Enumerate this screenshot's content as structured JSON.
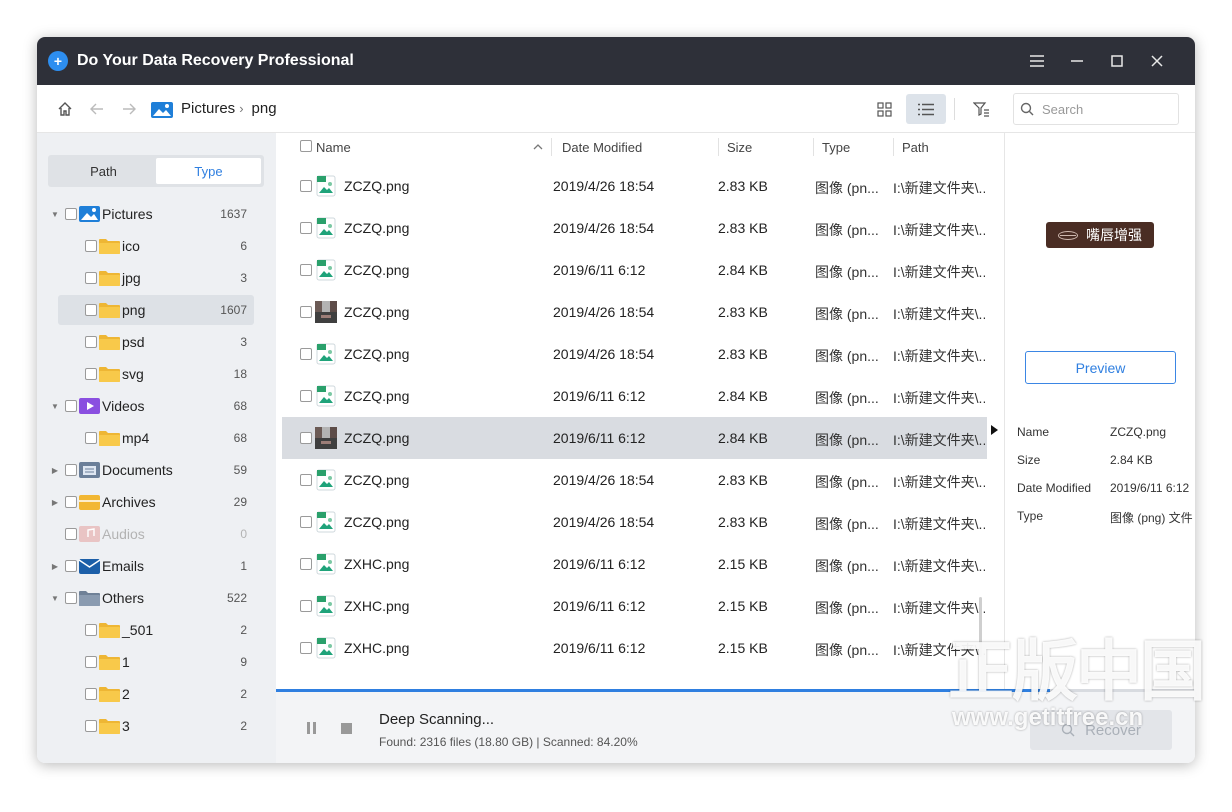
{
  "app": {
    "title": "Do Your Data Recovery  Professional"
  },
  "nav": {
    "crumbs": [
      "Pictures",
      "png"
    ],
    "search_placeholder": "Search"
  },
  "sidebar": {
    "tabs": [
      {
        "label": "Path",
        "active": false
      },
      {
        "label": "Type",
        "active": true
      }
    ],
    "tree": [
      {
        "label": "Pictures",
        "count": "1637",
        "level": 0,
        "expanded": true,
        "icon": "pictures-icon"
      },
      {
        "label": "ico",
        "count": "6",
        "level": 1,
        "icon": "folder-icon"
      },
      {
        "label": "jpg",
        "count": "3",
        "level": 1,
        "icon": "folder-icon"
      },
      {
        "label": "png",
        "count": "1607",
        "level": 1,
        "icon": "folder-icon",
        "selected": true
      },
      {
        "label": "psd",
        "count": "3",
        "level": 1,
        "icon": "folder-icon"
      },
      {
        "label": "svg",
        "count": "18",
        "level": 1,
        "icon": "folder-icon"
      },
      {
        "label": "Videos",
        "count": "68",
        "level": 0,
        "expanded": true,
        "icon": "videos-icon"
      },
      {
        "label": "mp4",
        "count": "68",
        "level": 1,
        "icon": "folder-icon"
      },
      {
        "label": "Documents",
        "count": "59",
        "level": 0,
        "expanded": false,
        "icon": "documents-icon"
      },
      {
        "label": "Archives",
        "count": "29",
        "level": 0,
        "expanded": false,
        "icon": "archives-icon"
      },
      {
        "label": "Audios",
        "count": "0",
        "level": 0,
        "disabled": true,
        "icon": "audios-icon"
      },
      {
        "label": "Emails",
        "count": "1",
        "level": 0,
        "expanded": false,
        "icon": "emails-icon"
      },
      {
        "label": "Others",
        "count": "522",
        "level": 0,
        "expanded": true,
        "icon": "others-icon"
      },
      {
        "label": "_501",
        "count": "2",
        "level": 1,
        "icon": "folder-icon"
      },
      {
        "label": "1",
        "count": "9",
        "level": 1,
        "icon": "folder-icon"
      },
      {
        "label": "2",
        "count": "2",
        "level": 1,
        "icon": "folder-icon"
      },
      {
        "label": "3",
        "count": "2",
        "level": 1,
        "icon": "folder-icon"
      }
    ]
  },
  "table": {
    "columns": {
      "name": "Name",
      "date": "Date Modified",
      "size": "Size",
      "type": "Type",
      "path": "Path"
    },
    "rows": [
      {
        "name": "ZCZQ.png",
        "date": "2019/4/26 18:54",
        "size": "2.83 KB",
        "type": "图像 (pn...",
        "path": "I:\\新建文件夹\\...",
        "thumb": "image-icon"
      },
      {
        "name": "ZCZQ.png",
        "date": "2019/4/26 18:54",
        "size": "2.83 KB",
        "type": "图像 (pn...",
        "path": "I:\\新建文件夹\\...",
        "thumb": "image-icon"
      },
      {
        "name": "ZCZQ.png",
        "date": "2019/6/11 6:12",
        "size": "2.84 KB",
        "type": "图像 (pn...",
        "path": "I:\\新建文件夹\\...",
        "thumb": "image-icon"
      },
      {
        "name": "ZCZQ.png",
        "date": "2019/4/26 18:54",
        "size": "2.83 KB",
        "type": "图像 (pn...",
        "path": "I:\\新建文件夹\\...",
        "thumb": "photo-thumbnail"
      },
      {
        "name": "ZCZQ.png",
        "date": "2019/4/26 18:54",
        "size": "2.83 KB",
        "type": "图像 (pn...",
        "path": "I:\\新建文件夹\\...",
        "thumb": "image-icon"
      },
      {
        "name": "ZCZQ.png",
        "date": "2019/6/11 6:12",
        "size": "2.84 KB",
        "type": "图像 (pn...",
        "path": "I:\\新建文件夹\\...",
        "thumb": "image-icon"
      },
      {
        "name": "ZCZQ.png",
        "date": "2019/6/11 6:12",
        "size": "2.84 KB",
        "type": "图像 (pn...",
        "path": "I:\\新建文件夹\\...",
        "thumb": "photo-thumbnail",
        "selected": true
      },
      {
        "name": "ZCZQ.png",
        "date": "2019/4/26 18:54",
        "size": "2.83 KB",
        "type": "图像 (pn...",
        "path": "I:\\新建文件夹\\...",
        "thumb": "image-icon"
      },
      {
        "name": "ZCZQ.png",
        "date": "2019/4/26 18:54",
        "size": "2.83 KB",
        "type": "图像 (pn...",
        "path": "I:\\新建文件夹\\...",
        "thumb": "image-icon"
      },
      {
        "name": "ZXHC.png",
        "date": "2019/6/11 6:12",
        "size": "2.15 KB",
        "type": "图像 (pn...",
        "path": "I:\\新建文件夹\\...",
        "thumb": "image-icon"
      },
      {
        "name": "ZXHC.png",
        "date": "2019/6/11 6:12",
        "size": "2.15 KB",
        "type": "图像 (pn...",
        "path": "I:\\新建文件夹\\...",
        "thumb": "image-icon"
      },
      {
        "name": "ZXHC.png",
        "date": "2019/6/11 6:12",
        "size": "2.15 KB",
        "type": "图像 (pn...",
        "path": "I:\\新建文件夹\\...",
        "thumb": "image-icon"
      }
    ]
  },
  "preview": {
    "thumb_text": "嘴唇增强",
    "button": "Preview",
    "info": [
      {
        "k": "Name",
        "v": "ZCZQ.png"
      },
      {
        "k": "Size",
        "v": "2.84 KB"
      },
      {
        "k": "Date Modified",
        "v": "2019/6/11 6:12"
      },
      {
        "k": "Type",
        "v": "图像 (png) 文件"
      }
    ]
  },
  "scan": {
    "title": "Deep Scanning...",
    "status": "Found: 2316 files (18.80 GB) | Scanned: 84.20%",
    "progress": 0.842,
    "recover_label": "Recover"
  },
  "watermark": {
    "big": "正版中国",
    "small": "www.getitfree.cn"
  },
  "colors": {
    "accent": "#2f7fe0",
    "titlebar": "#2e3039",
    "folder": "#f7c646",
    "sidebar_bg": "#eef0f3"
  }
}
